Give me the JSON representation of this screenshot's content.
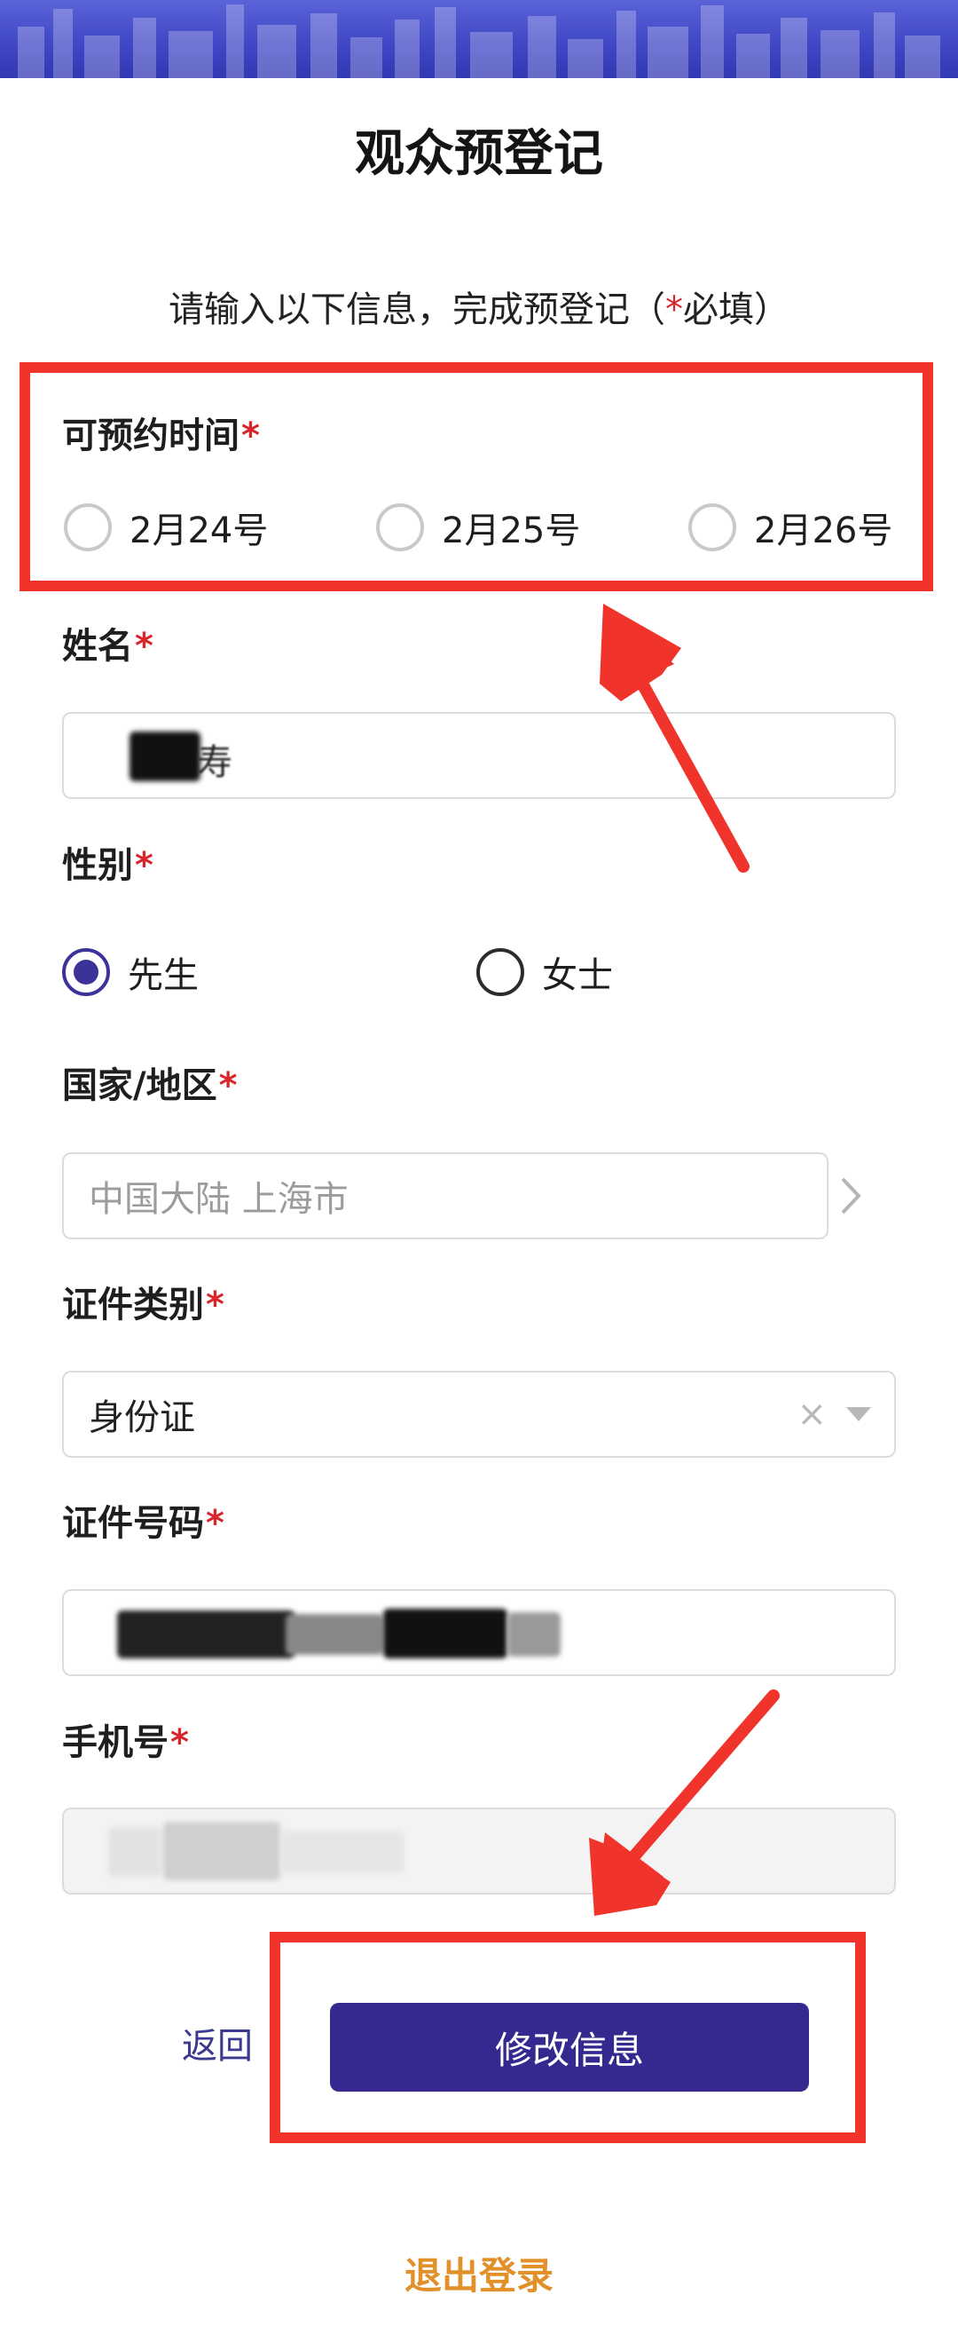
{
  "page": {
    "title": "观众预登记",
    "subtitle_text": "请输入以下信息，完成预登记（",
    "subtitle_star": "*",
    "subtitle_end": "必填）"
  },
  "form": {
    "date": {
      "label": "可预约时间",
      "required_mark": "*",
      "options": [
        {
          "label": "2月24号",
          "selected": false
        },
        {
          "label": "2月25号",
          "selected": false
        },
        {
          "label": "2月26号",
          "selected": false
        }
      ]
    },
    "name": {
      "label": "姓名",
      "required_mark": "*",
      "value_visible": "寿"
    },
    "gender": {
      "label": "性别",
      "required_mark": "*",
      "options": [
        {
          "label": "先生",
          "selected": true
        },
        {
          "label": "女士",
          "selected": false
        }
      ]
    },
    "region": {
      "label": "国家/地区",
      "required_mark": "*",
      "value": "中国大陆 上海市"
    },
    "id_type": {
      "label": "证件类别",
      "required_mark": "*",
      "value": "身份证",
      "clear_glyph": "×"
    },
    "id_number": {
      "label": "证件号码",
      "required_mark": "*"
    },
    "phone": {
      "label": "手机号",
      "required_mark": "*"
    }
  },
  "actions": {
    "back_label": "返回",
    "submit_label": "修改信息",
    "logout_label": "退出登录"
  },
  "colors": {
    "banner": "#4047c4",
    "required": "#d8262c",
    "primary_button": "#35288f",
    "logout": "#e2902a",
    "annotation": "#f0342c"
  }
}
